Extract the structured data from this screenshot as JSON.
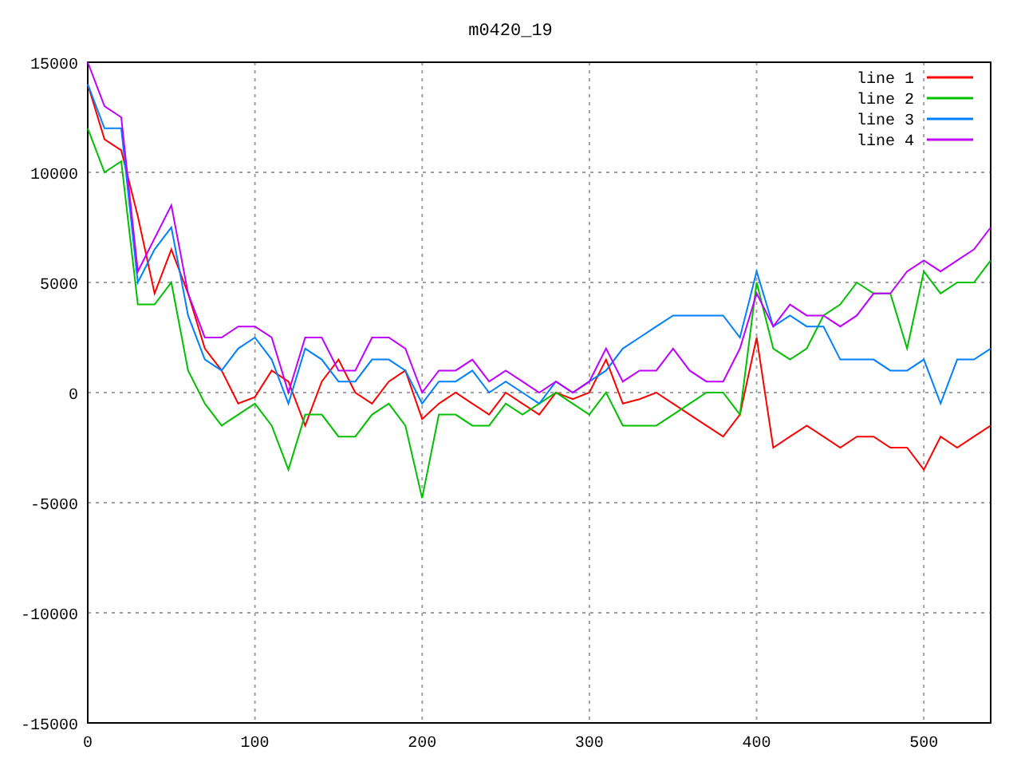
{
  "chart": {
    "chart_data": {
      "type": "line",
      "title": "m0420_19",
      "grid": true,
      "legend": true,
      "xlim": [
        0,
        540
      ],
      "ylim": [
        -15000,
        15000
      ],
      "xticks": [
        0,
        100,
        200,
        300,
        400,
        500
      ],
      "yticks": [
        -15000,
        -10000,
        -5000,
        0,
        5000,
        10000,
        15000
      ],
      "x": [
        0,
        10,
        20,
        30,
        40,
        50,
        60,
        70,
        80,
        90,
        100,
        110,
        120,
        130,
        140,
        150,
        160,
        170,
        180,
        190,
        200,
        210,
        220,
        230,
        240,
        250,
        260,
        270,
        280,
        290,
        300,
        310,
        320,
        330,
        340,
        350,
        360,
        370,
        380,
        390,
        400,
        410,
        420,
        430,
        440,
        450,
        460,
        470,
        480,
        490,
        500,
        510,
        520,
        530,
        540
      ],
      "series": [
        {
          "name": "line 1",
          "color": "#ff0000",
          "values": [
            14000,
            11500,
            11000,
            8000,
            4500,
            6500,
            4500,
            2000,
            1000,
            -500,
            -200,
            1000,
            500,
            -1500,
            500,
            1500,
            0,
            -500,
            500,
            1000,
            -1200,
            -500,
            0,
            -500,
            -1000,
            0,
            -500,
            -1000,
            0,
            -300,
            0,
            1500,
            -500,
            -300,
            0,
            -500,
            -1000,
            -1500,
            -2000,
            -1000,
            2500,
            -2500,
            -2000,
            -1500,
            -2000,
            -2500,
            -2000,
            -2000,
            -2500,
            -2500,
            -3500,
            -2000,
            -2500,
            -2000,
            -1500
          ]
        },
        {
          "name": "line 2",
          "color": "#00c000",
          "values": [
            12000,
            10000,
            10500,
            4000,
            4000,
            5000,
            1000,
            -500,
            -1500,
            -1000,
            -500,
            -1500,
            -3500,
            -1000,
            -1000,
            -2000,
            -2000,
            -1000,
            -500,
            -1500,
            -4800,
            -1000,
            -1000,
            -1500,
            -1500,
            -500,
            -1000,
            -500,
            0,
            -500,
            -1000,
            0,
            -1500,
            -1500,
            -1500,
            -1000,
            -500,
            0,
            0,
            -1000,
            5000,
            2000,
            1500,
            2000,
            3500,
            4000,
            5000,
            4500,
            4500,
            2000,
            5500,
            4500,
            5000,
            5000,
            6000
          ]
        },
        {
          "name": "line 3",
          "color": "#0080ff",
          "values": [
            14000,
            12000,
            12000,
            5000,
            6500,
            7500,
            3500,
            1500,
            1000,
            2000,
            2500,
            1500,
            -500,
            2000,
            1500,
            500,
            500,
            1500,
            1500,
            1000,
            -500,
            500,
            500,
            1000,
            0,
            500,
            0,
            -500,
            500,
            0,
            500,
            1000,
            2000,
            2500,
            3000,
            3500,
            3500,
            3500,
            3500,
            2500,
            5500,
            3000,
            3500,
            3000,
            3000,
            1500,
            1500,
            1500,
            1000,
            1000,
            1500,
            -500,
            1500,
            1500,
            2000
          ]
        },
        {
          "name": "line 4",
          "color": "#c000ff",
          "values": [
            15000,
            13000,
            12500,
            5500,
            7000,
            8500,
            4500,
            2500,
            2500,
            3000,
            3000,
            2500,
            0,
            2500,
            2500,
            1000,
            1000,
            2500,
            2500,
            2000,
            0,
            1000,
            1000,
            1500,
            500,
            1000,
            500,
            0,
            500,
            0,
            500,
            2000,
            500,
            1000,
            1000,
            2000,
            1000,
            500,
            500,
            2000,
            4500,
            3000,
            4000,
            3500,
            3500,
            3000,
            3500,
            4500,
            4500,
            5500,
            6000,
            5500,
            6000,
            6500,
            7500
          ]
        }
      ]
    }
  }
}
